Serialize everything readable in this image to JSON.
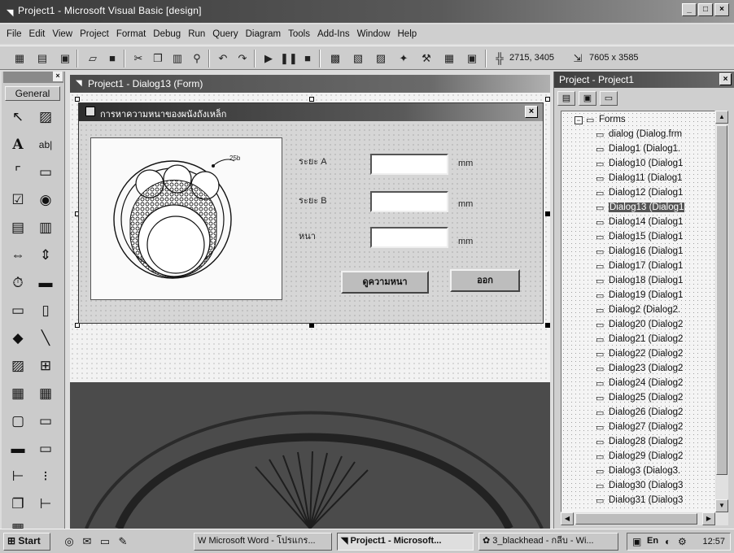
{
  "app": {
    "title": "Project1 - Microsoft Visual Basic [design]",
    "window_buttons": [
      "_",
      "□",
      "×"
    ]
  },
  "menu": [
    "File",
    "Edit",
    "View",
    "Project",
    "Format",
    "Debug",
    "Run",
    "Query",
    "Diagram",
    "Tools",
    "Add-Ins",
    "Window",
    "Help"
  ],
  "toolbar": {
    "position": "2715, 3405",
    "size": "7605 x 3585"
  },
  "toolbox": {
    "tab": "General",
    "tools": [
      "pointer",
      "picturebox",
      "label",
      "textbox",
      "frame",
      "commandbutton",
      "checkbox",
      "optionbutton",
      "combobox",
      "listbox",
      "hscrollbar",
      "vscrollbar",
      "timer",
      "drivelistbox",
      "dirlistbox",
      "filelistbox",
      "shape",
      "line",
      "image",
      "data",
      "ole",
      "grid",
      "extra1",
      "extra2",
      "extra3",
      "extra4",
      "extra5",
      "extra6",
      "extra7"
    ]
  },
  "designer": {
    "title": "Project1 - Dialog13 (Form)"
  },
  "form": {
    "title": "การหาความหนาของผนังถังเหล็ก",
    "close": "×",
    "labels": {
      "a": "ระยะ A",
      "b": "ระยะ B",
      "thick": "หนา"
    },
    "units": {
      "a": "mm",
      "b": "mm",
      "thick": "mm"
    },
    "textboxes": {
      "a": "",
      "b": "",
      "thick": ""
    },
    "buttons": {
      "compute": "ดูความหนา",
      "exit": "ออก"
    },
    "diagram_label": "25b"
  },
  "project": {
    "title": "Project - Project1",
    "close": "×",
    "folder": "Forms",
    "folder_toggle": "−",
    "items": [
      "dialog (Dialog.frm",
      "Dialog1 (Dialog1.",
      "Dialog10 (Dialog1",
      "Dialog11 (Dialog1",
      "Dialog12 (Dialog1",
      "Dialog13 (Dialog1",
      "Dialog14 (Dialog1",
      "Dialog15 (Dialog1",
      "Dialog16 (Dialog1",
      "Dialog17 (Dialog1",
      "Dialog18 (Dialog1",
      "Dialog19 (Dialog1",
      "Dialog2 (Dialog2.",
      "Dialog20 (Dialog2",
      "Dialog21 (Dialog2",
      "Dialog22 (Dialog2",
      "Dialog23 (Dialog2",
      "Dialog24 (Dialog2",
      "Dialog25 (Dialog2",
      "Dialog26 (Dialog2",
      "Dialog27 (Dialog2",
      "Dialog28 (Dialog2",
      "Dialog29 (Dialog2",
      "Dialog3 (Dialog3.",
      "Dialog30 (Dialog3",
      "Dialog31 (Dialog3"
    ],
    "selected_index": 5
  },
  "taskbar": {
    "start": "Start",
    "tasks": [
      "Microsoft Word - โปรแกร...",
      "Project1 - Microsoft...",
      "3_blackhead - กลีบ - Wi..."
    ],
    "active_task": 1,
    "clock": "12:57"
  }
}
